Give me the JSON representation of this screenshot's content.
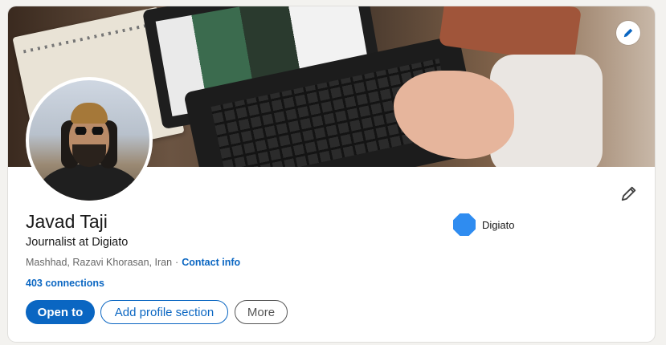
{
  "profile": {
    "name": "Javad Taji",
    "headline": "Journalist at Digiato",
    "location": "Mashhad, Razavi Khorasan, Iran",
    "separator": "·",
    "contact_info_label": "Contact info",
    "connections_label": "403 connections"
  },
  "company": {
    "name": "Digiato",
    "logo_color": "#2f8cf0"
  },
  "actions": {
    "open_to_label": "Open to",
    "add_section_label": "Add profile section",
    "more_label": "More"
  },
  "icons": {
    "cover_edit": "pencil-icon",
    "profile_edit": "pencil-icon"
  },
  "colors": {
    "accent": "#0a66c2",
    "text": "#191919",
    "muted": "#666666",
    "page_bg": "#f3f2ef"
  }
}
